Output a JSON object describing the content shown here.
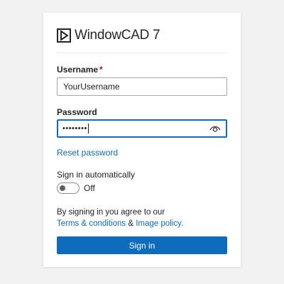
{
  "app": {
    "title": "WindowCAD 7",
    "logo_icon": "play-box-icon"
  },
  "username": {
    "label": "Username",
    "required_marker": "*",
    "value": "YourUsername"
  },
  "password": {
    "label": "Password",
    "masked_value": "••••••••",
    "reveal_icon": "eye-icon"
  },
  "reset_link": "Reset password",
  "auto_signin": {
    "label": "Sign in automatically",
    "state_text": "Off",
    "checked": false
  },
  "terms": {
    "prefix": "By signing in you agree to our",
    "terms_link": "Terms & conditions",
    "joiner": "&",
    "policy_link": "Image policy",
    "suffix": "."
  },
  "signin_button": "Sign in",
  "colors": {
    "accent": "#0f6cbd",
    "required": "#c50f1f",
    "background": "#f2f2f2"
  }
}
